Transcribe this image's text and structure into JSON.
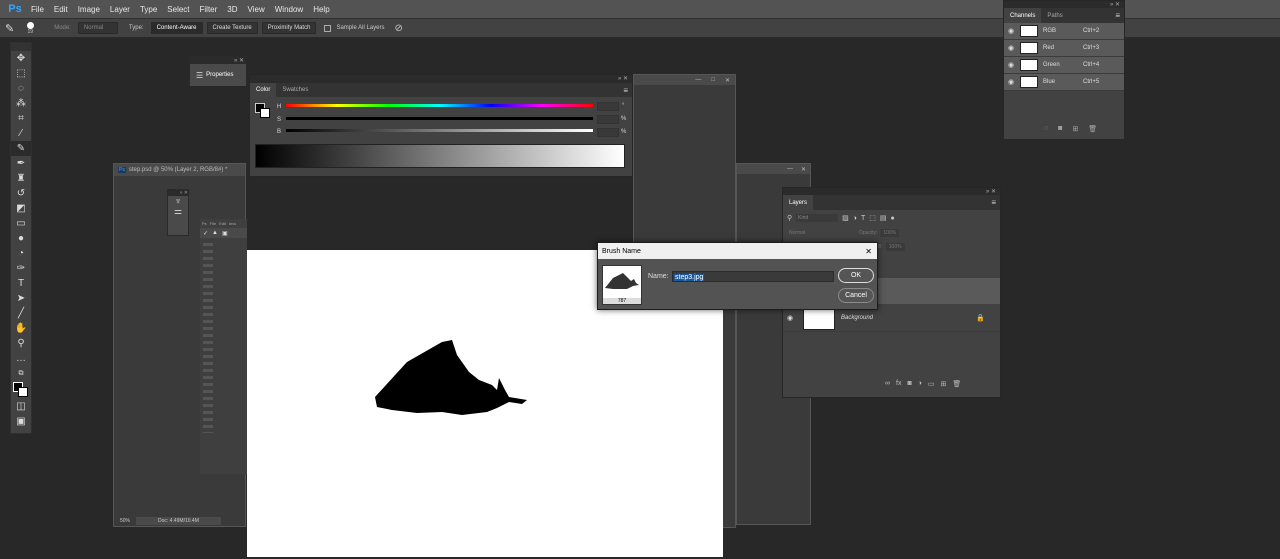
{
  "app": {
    "logo": "Ps"
  },
  "menu": [
    "File",
    "Edit",
    "Image",
    "Layer",
    "Type",
    "Select",
    "Filter",
    "3D",
    "View",
    "Window",
    "Help"
  ],
  "options": {
    "brush_size": "19",
    "mode_label": "Mode:",
    "mode_value": "Normal",
    "type_label": "Type:",
    "btn_content_aware": "Content-Aware",
    "btn_create_texture": "Create Texture",
    "btn_proximity": "Proximity Match",
    "sample_all": "Sample All Layers"
  },
  "properties_panel": {
    "label": "Properties"
  },
  "color_panel": {
    "tabs": [
      "Color",
      "Swatches"
    ],
    "sliders": [
      {
        "label": "H",
        "unit": "°"
      },
      {
        "label": "S",
        "unit": "%"
      },
      {
        "label": "B",
        "unit": "%"
      }
    ]
  },
  "document": {
    "title": "step.psd @ 50% (Layer 2, RGB/8#) *",
    "zoom": "50%",
    "doc_info": "Doc: 4.49M/10.4M",
    "mini_tabs": [
      "Ps",
      "File",
      "Edit",
      "Ima"
    ]
  },
  "channels_panel": {
    "tabs": [
      "Channels",
      "Paths"
    ],
    "channels": [
      {
        "name": "RGB",
        "shortcut": "Ctrl+2"
      },
      {
        "name": "Red",
        "shortcut": "Ctrl+3"
      },
      {
        "name": "Green",
        "shortcut": "Ctrl+4"
      },
      {
        "name": "Blue",
        "shortcut": "Ctrl+5"
      }
    ]
  },
  "layers_panel": {
    "title": "Layers",
    "kind_placeholder": "Kind",
    "blend_mode": "Normal",
    "opacity_label": "Opacity:",
    "opacity_value": "100%",
    "fill_label": "Fill:",
    "fill_value": "100%",
    "layers": [
      {
        "name": "Background",
        "locked": true
      }
    ]
  },
  "brush_dialog": {
    "title": "Brush Name",
    "name_label": "Name:",
    "name_value": "step3.jpg",
    "preview_size": "787",
    "ok": "OK",
    "cancel": "Cancel"
  },
  "colors": {
    "accent": "#31a8ff",
    "selection": "#1c5a9e"
  }
}
